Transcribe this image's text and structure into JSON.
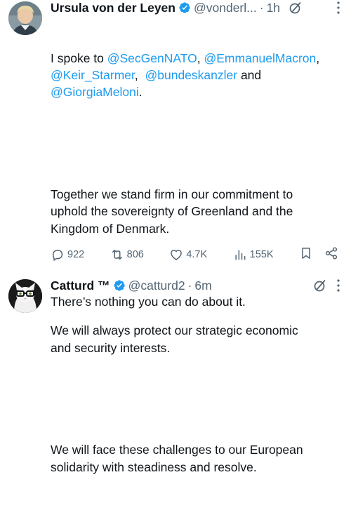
{
  "tweets": [
    {
      "author": "Ursula von der Leyen",
      "handle": "@vonderl...",
      "separator": "·",
      "time": "1h",
      "intro_text": "I spoke to ",
      "mentions": [
        "@SecGenNATO",
        "@EmmanuelMacron",
        "@Keir_Starmer",
        "@bundeskanzler",
        "@GiorgiaMeloni"
      ],
      "connectors": [
        ", ",
        ",\n",
        ",  ",
        " and\n",
        "."
      ],
      "paragraphs": [
        "Together we stand firm in our commitment to\nuphold the sovereignty of Greenland and the\nKingdom of Denmark.",
        "We will always protect our strategic economic\nand security interests.",
        "We will face these challenges to our European\nsolidarity with steadiness and resolve."
      ],
      "stats": {
        "replies": "922",
        "reposts": "806",
        "likes": "4.7K",
        "views": "155K"
      }
    },
    {
      "author": "Catturd ™",
      "handle": "@catturd2",
      "separator": "·",
      "time": "6m",
      "text": "There’s nothing you can do about it."
    }
  ],
  "colors": {
    "link": "#1d9bf0",
    "verified": "#1d9bf0",
    "secondary": "#536471",
    "text": "#0f1419"
  },
  "icons": [
    "verified-badge-icon",
    "grok-icon",
    "more-icon",
    "reply-icon",
    "repost-icon",
    "like-icon",
    "views-icon",
    "bookmark-icon",
    "share-icon"
  ]
}
